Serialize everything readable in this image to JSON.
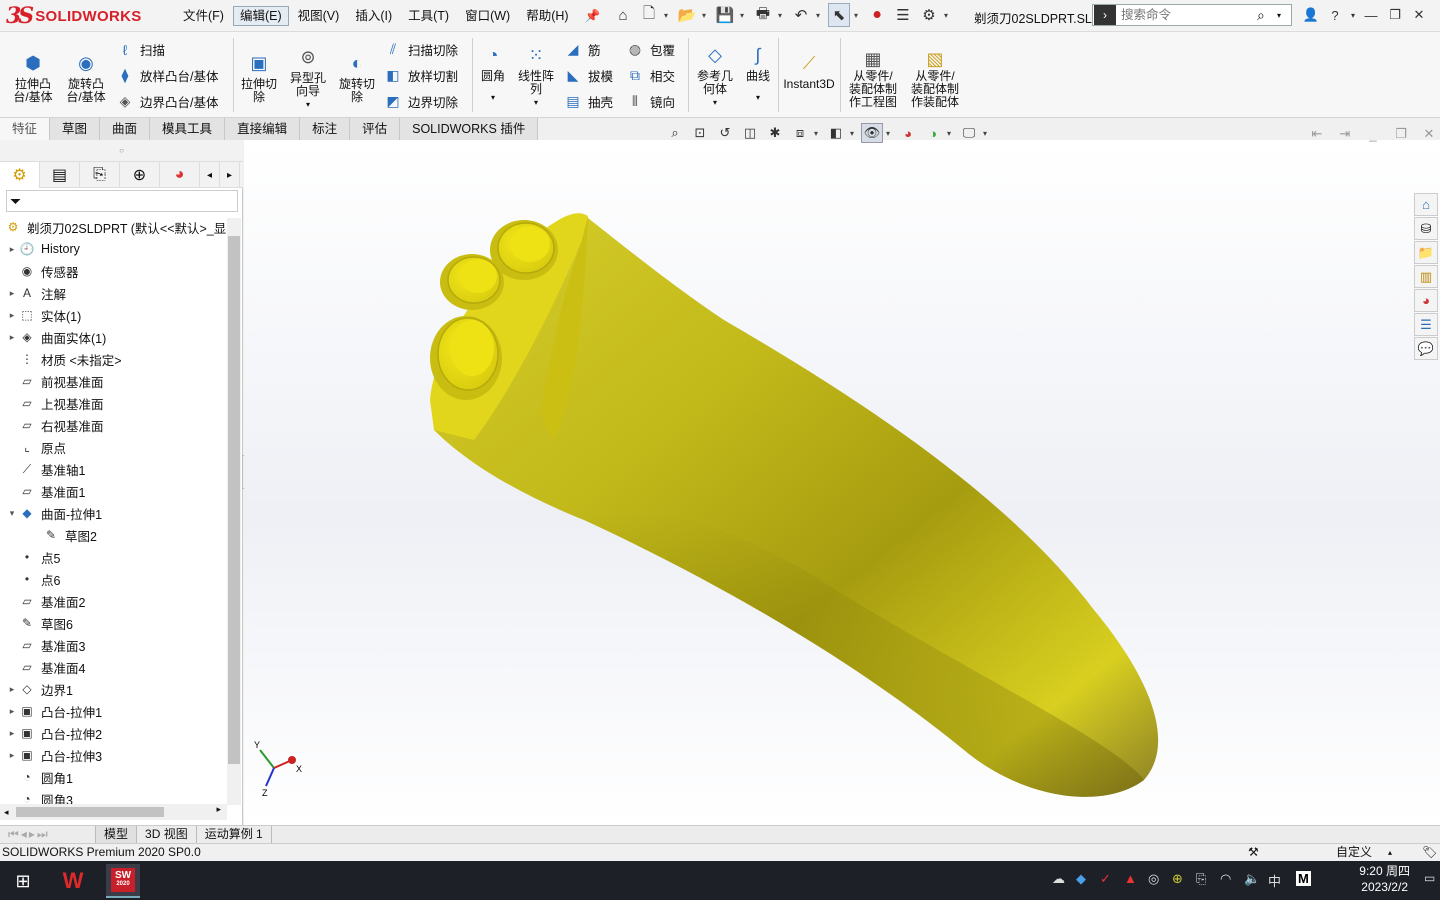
{
  "app": {
    "logo_mark": "3S",
    "logo_text": "SOLIDWORKS"
  },
  "menu": [
    "文件(F)",
    "编辑(E)",
    "视图(V)",
    "插入(I)",
    "工具(T)",
    "窗口(W)",
    "帮助(H)"
  ],
  "document_title": "剃须刀02SLDPRT.SL...",
  "search": {
    "placeholder": "搜索命令"
  },
  "ribbon": {
    "extrude_boss": "拉伸凸\n台/基体",
    "revolve_boss": "旋转凸\n台/基体",
    "sweep": "扫描",
    "loft_boss": "放样凸台/基体",
    "boundary_boss": "边界凸台/基体",
    "extrude_cut": "拉伸切\n除",
    "hole_wizard": "异型孔\n向导",
    "revolve_cut": "旋转切\n除",
    "swept_cut": "扫描切除",
    "lofted_cut": "放样切割",
    "boundary_cut": "边界切除",
    "fillet": "圆角",
    "linear_pattern": "线性阵\n列",
    "rib": "筋",
    "draft": "拔模",
    "shell": "抽壳",
    "wrap": "包覆",
    "intersect": "相交",
    "mirror": "镜向",
    "ref_geometry": "参考几\n何体",
    "curves": "曲线",
    "instant3d": "Instant3D",
    "make_drawing": "从零件/\n装配体制\n作工程图",
    "make_assembly": "从零件/\n装配体制\n作装配体"
  },
  "tabs": [
    "特征",
    "草图",
    "曲面",
    "模具工具",
    "直接编辑",
    "标注",
    "评估",
    "SOLIDWORKS 插件"
  ],
  "tree": {
    "root": "剃须刀02SLDPRT  (默认<<默认>_显",
    "items": [
      {
        "label": "History",
        "toggle": "▸",
        "icon": "history-icon",
        "indent": 0
      },
      {
        "label": "传感器",
        "toggle": "",
        "icon": "sensor-icon",
        "indent": 0
      },
      {
        "label": "注解",
        "toggle": "▸",
        "icon": "annotation-icon",
        "indent": 0
      },
      {
        "label": "实体(1)",
        "toggle": "▸",
        "icon": "solid-body-icon",
        "indent": 0
      },
      {
        "label": "曲面实体(1)",
        "toggle": "▸",
        "icon": "surface-body-icon",
        "indent": 0
      },
      {
        "label": "材质 <未指定>",
        "toggle": "",
        "icon": "material-icon",
        "indent": 0
      },
      {
        "label": "前视基准面",
        "toggle": "",
        "icon": "plane-icon",
        "indent": 0
      },
      {
        "label": "上视基准面",
        "toggle": "",
        "icon": "plane-icon",
        "indent": 0
      },
      {
        "label": "右视基准面",
        "toggle": "",
        "icon": "plane-icon",
        "indent": 0
      },
      {
        "label": "原点",
        "toggle": "",
        "icon": "origin-icon",
        "indent": 0
      },
      {
        "label": "基准轴1",
        "toggle": "",
        "icon": "axis-icon",
        "indent": 0
      },
      {
        "label": "基准面1",
        "toggle": "",
        "icon": "plane-icon",
        "indent": 0
      },
      {
        "label": "曲面-拉伸1",
        "toggle": "▾",
        "icon": "surface-extrude-icon",
        "indent": 0
      },
      {
        "label": "草图2",
        "toggle": "",
        "icon": "sketch-icon",
        "indent": 1
      },
      {
        "label": "点5",
        "toggle": "",
        "icon": "point-icon",
        "indent": 0
      },
      {
        "label": "点6",
        "toggle": "",
        "icon": "point-icon",
        "indent": 0
      },
      {
        "label": "基准面2",
        "toggle": "",
        "icon": "plane-icon",
        "indent": 0
      },
      {
        "label": "草图6",
        "toggle": "",
        "icon": "sketch-icon",
        "indent": 0
      },
      {
        "label": "基准面3",
        "toggle": "",
        "icon": "plane-icon",
        "indent": 0
      },
      {
        "label": "基准面4",
        "toggle": "",
        "icon": "plane-icon",
        "indent": 0
      },
      {
        "label": "边界1",
        "toggle": "▸",
        "icon": "boundary-icon",
        "indent": 0
      },
      {
        "label": "凸台-拉伸1",
        "toggle": "▸",
        "icon": "boss-extrude-icon",
        "indent": 0
      },
      {
        "label": "凸台-拉伸2",
        "toggle": "▸",
        "icon": "boss-extrude-icon",
        "indent": 0
      },
      {
        "label": "凸台-拉伸3",
        "toggle": "▸",
        "icon": "boss-extrude-icon",
        "indent": 0
      },
      {
        "label": "圆角1",
        "toggle": "",
        "icon": "fillet-icon",
        "indent": 0
      },
      {
        "label": "圆角3",
        "toggle": "",
        "icon": "fillet-icon",
        "indent": 0
      }
    ]
  },
  "triad": {
    "y": "Y",
    "x": "X",
    "z": "Z"
  },
  "bottom_tabs": [
    "模型",
    "3D 视图",
    "运动算例 1"
  ],
  "status": {
    "version": "SOLIDWORKS Premium 2020 SP0.0",
    "units": "自定义"
  },
  "taskbar": {
    "time": "9:20 周四",
    "date": "2023/2/2",
    "ime": "中",
    "sw_year": "2020"
  },
  "colors": {
    "part_yellow": "#d9cf1a",
    "brand_red": "#d8202a",
    "accent_blue": "#2a6ebd"
  }
}
